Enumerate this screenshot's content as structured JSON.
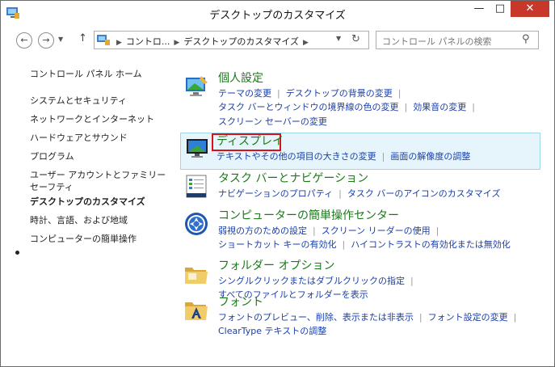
{
  "window": {
    "title": "デスクトップのカスタマイズ"
  },
  "caption_buttons": {
    "minimize": "—",
    "maximize": "□",
    "close": "✕"
  },
  "nav": {
    "back_glyph": "←",
    "forward_glyph": "→",
    "up_glyph": "↑",
    "breadcrumb_root": "コントロ...",
    "breadcrumb_current": "デスクトップのカスタマイズ",
    "search_placeholder": "コントロール パネルの検索"
  },
  "sidebar": {
    "items": [
      "コントロール パネル ホーム",
      "システムとセキュリティ",
      "ネットワークとインターネット",
      "ハードウェアとサウンド",
      "プログラム",
      "ユーザー アカウントとファミリー セーフティ",
      "デスクトップのカスタマイズ",
      "時計、言語、および地域",
      "コンピューターの簡単操作"
    ],
    "current_index": 6
  },
  "categories": [
    {
      "title": "個人設定",
      "links": [
        "テーマの変更",
        "デスクトップの背景の変更",
        "タスク バーとウィンドウの境界線の色の変更",
        "効果音の変更",
        "スクリーン セーバーの変更"
      ]
    },
    {
      "title": "ディスプレイ",
      "links": [
        "テキストやその他の項目の大きさの変更",
        "画面の解像度の調整"
      ]
    },
    {
      "title": "タスク バーとナビゲーション",
      "links": [
        "ナビゲーションのプロパティ",
        "タスク バーのアイコンのカスタマイズ"
      ]
    },
    {
      "title": "コンピューターの簡単操作センター",
      "links": [
        "弱視の方のための設定",
        "スクリーン リーダーの使用",
        "ショートカット キーの有効化",
        "ハイコントラストの有効化または無効化"
      ]
    },
    {
      "title": "フォルダー オプション",
      "links": [
        "シングルクリックまたはダブルクリックの指定",
        "すべてのファイルとフォルダーを表示"
      ]
    },
    {
      "title": "フォント",
      "links": [
        "フォントのプレビュー、削除、表示または非表示",
        "フォント設定の変更",
        "ClearType テキストの調整"
      ]
    }
  ],
  "colors": {
    "category_title": "#1a7a1a",
    "link": "#1a3fa8",
    "highlight_bg": "#e6f5fb",
    "annotation_box": "#d9111a",
    "close_button": "#c7382b"
  }
}
